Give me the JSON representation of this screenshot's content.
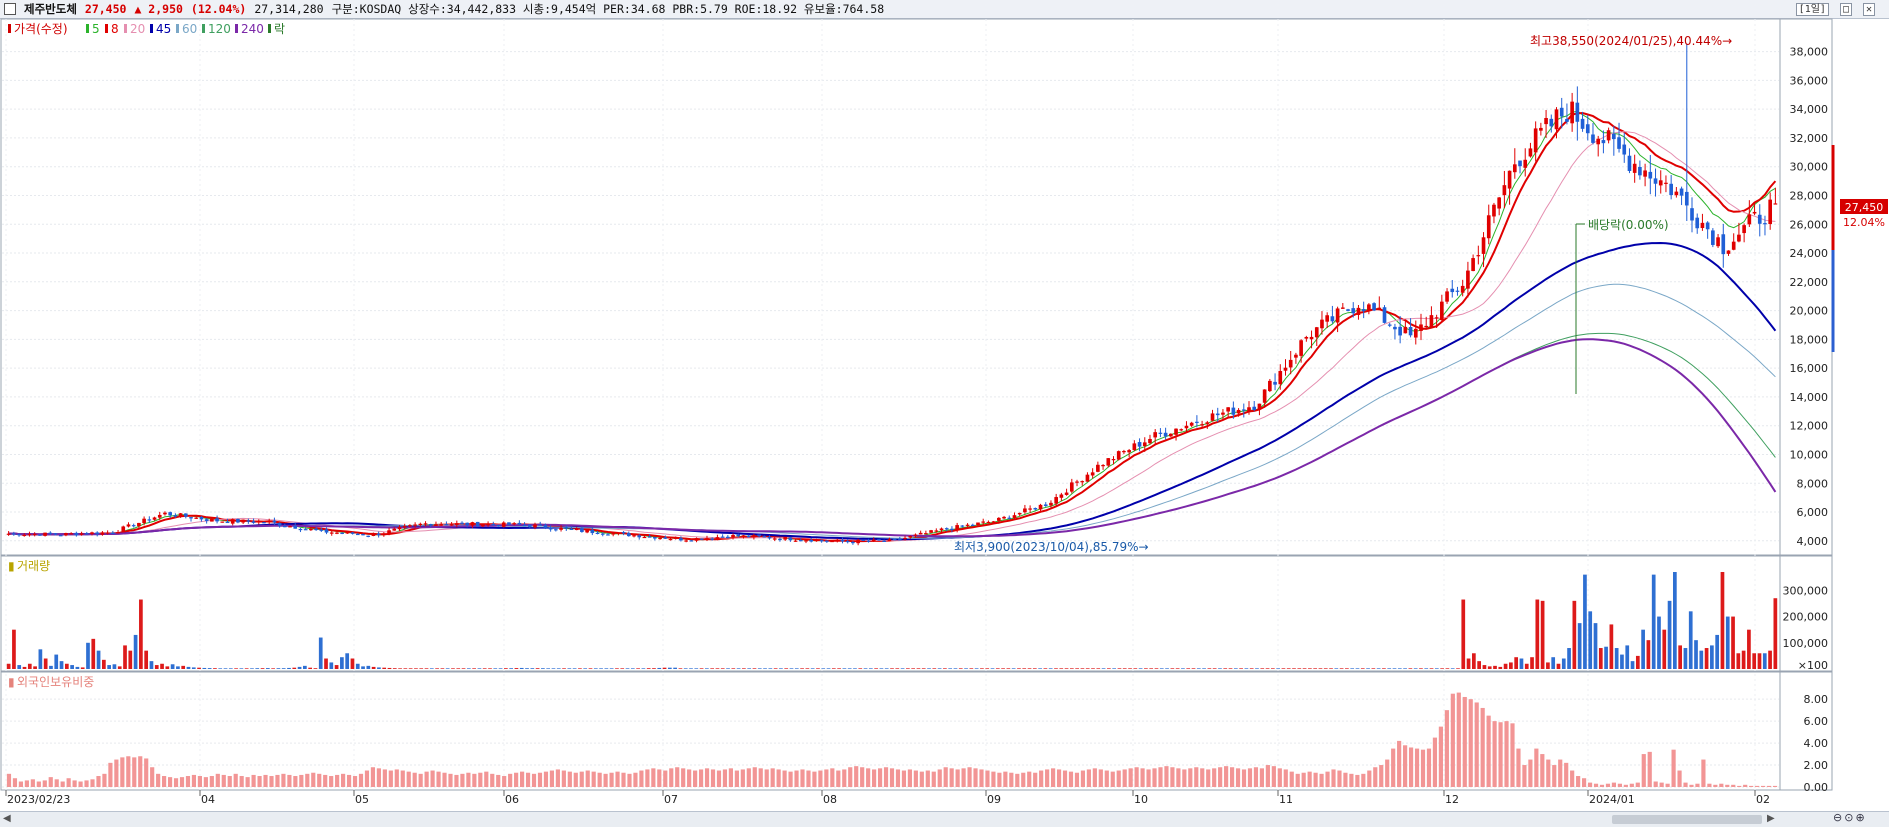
{
  "header": {
    "name": "제주반도체",
    "price": "27,450",
    "change": "▲ 2,950",
    "pct": "(12.04%)",
    "volume": "27,314,280",
    "info": "구분:KOSDAQ 상장수:34,442,833 시총:9,454억 PER:34.68 PBR:5.79 ROE:18.92 유보율:764.58",
    "period": "[1일]",
    "ctrl_min": "□",
    "ctrl_close": "✕"
  },
  "legend_price": [
    {
      "label": "가격(수정)",
      "color": "#d00000"
    },
    {
      "label": "5",
      "color": "#2bb32b"
    },
    {
      "label": "8",
      "color": "#e00000"
    },
    {
      "label": "20",
      "color": "#e58fb0"
    },
    {
      "label": "45",
      "color": "#0000aa"
    },
    {
      "label": "60",
      "color": "#7aa7c7"
    },
    {
      "label": "120",
      "color": "#3f9f5f"
    },
    {
      "label": "240",
      "color": "#7b28a8"
    },
    {
      "label": "락",
      "color": "#2a7a2a"
    }
  ],
  "legend_volume": "거래량",
  "legend_foreign": "외국인보유비중",
  "annotations": {
    "high": "최고38,550(2024/01/25),40.44%→",
    "low": "최저3,900(2023/10/04),85.79%→",
    "dividend": "배당락(0.00%)",
    "last_price": "27,450",
    "last_pct": "12.04%"
  },
  "axes": {
    "price_ticks": [
      "38,000",
      "36,000",
      "34,000",
      "32,000",
      "30,000",
      "28,000",
      "26,000",
      "24,000",
      "22,000",
      "20,000",
      "18,000",
      "16,000",
      "14,000",
      "12,000",
      "10,000",
      "8,000",
      "6,000",
      "4,000"
    ],
    "volume_ticks": [
      "300,000",
      "200,000",
      "100,000",
      "×100"
    ],
    "foreign_ticks": [
      "8.00",
      "6.00",
      "4.00",
      "2.00",
      "0.00"
    ],
    "date_labels": [
      "2023/02/23",
      "04",
      "05",
      "06",
      "07",
      "08",
      "09",
      "10",
      "11",
      "12",
      "2024/01",
      "02"
    ]
  },
  "chart_data": [
    {
      "type": "candlestick",
      "title": "제주반도체",
      "ylim": [
        3500,
        39500
      ],
      "y_unit": "KRW",
      "series": [
        {
          "name": "가격(수정)",
          "anchor_prices": [
            4500,
            4450,
            4600,
            5900,
            5400,
            5300,
            4650,
            4400,
            5200,
            5150,
            5100,
            4700,
            4400,
            4100,
            4350,
            4150,
            3950,
            4000,
            4800,
            5400,
            6600,
            9300,
            11200,
            12500,
            13500,
            18300,
            20600,
            18100,
            22000,
            30500,
            34000,
            31000,
            28500,
            24500,
            27450
          ]
        },
        {
          "name": "5",
          "last_value": 28500
        },
        {
          "name": "8",
          "last_value": 29000
        },
        {
          "name": "20",
          "last_value": 26200
        },
        {
          "name": "45",
          "last_value": 18600
        },
        {
          "name": "60",
          "last_value": 15400
        },
        {
          "name": "120",
          "last_value": 9800
        },
        {
          "name": "240",
          "last_value": 7400
        }
      ],
      "high": {
        "value": 38550,
        "date": "2024/01/25",
        "pct": 40.44
      },
      "low": {
        "value": 3900,
        "date": "2023/10/04",
        "pct": 85.79
      },
      "last": {
        "price": 27450,
        "pct": 12.04
      }
    },
    {
      "type": "bar",
      "title": "거래량",
      "ylim": [
        0,
        370000
      ],
      "values": [
        20000,
        150000,
        15000,
        8000,
        20000,
        10000,
        75000,
        40000,
        12000,
        55000,
        30000,
        20000,
        15000,
        8000,
        6000,
        100000,
        115000,
        70000,
        35000,
        15000,
        18000,
        10000,
        90000,
        70000,
        130000,
        265000,
        70000,
        30000,
        15000,
        20000,
        10000,
        18000,
        10000,
        12000,
        8000,
        6000,
        5000,
        4000,
        3500,
        3000,
        2500,
        2500,
        2500,
        2500,
        2500,
        2500,
        2500,
        3000,
        3000,
        3500,
        2500,
        3000,
        3000,
        4000,
        5000,
        8000,
        12000,
        5000,
        3000,
        120000,
        40000,
        25000,
        15000,
        45000,
        60000,
        40000,
        20000,
        10000,
        12000,
        8000,
        6000,
        5000,
        4000,
        3000,
        2500,
        2500,
        2500,
        2500,
        2500,
        2500,
        2500,
        2500,
        2500,
        2500,
        2500,
        2500,
        2500,
        2500,
        2500,
        2500,
        2500,
        2500,
        2500,
        2500,
        3000,
        3000,
        3500,
        4000,
        3000,
        3000,
        3000,
        3000,
        2500,
        2500,
        2500,
        2500,
        2500,
        2500,
        2500,
        2500,
        2500,
        2500,
        2500,
        2500,
        2500,
        2500,
        2500,
        2500,
        2500,
        2500,
        2500,
        3000,
        3000,
        4000,
        5000,
        5000,
        5000,
        2500,
        2500,
        2500,
        2500,
        2500,
        2500,
        2500,
        2500,
        2500,
        2500,
        2500,
        2500,
        2500,
        2500,
        2500,
        2500,
        2500,
        2500,
        2500,
        2500,
        2500,
        2500,
        2500,
        2500,
        2500,
        2500,
        2500,
        2500,
        2500,
        2500,
        2500,
        2500,
        2500,
        2500,
        2500,
        2500,
        2500,
        2500,
        2500,
        2500,
        2500,
        2500,
        2500,
        2500,
        2500,
        2500,
        2500,
        2500,
        2500,
        2500,
        2500,
        2500,
        2500,
        2500,
        2500,
        2500,
        2500,
        2500,
        2500,
        2500,
        2500,
        2500,
        2500,
        2500,
        2500,
        2500,
        2500,
        2500,
        2500,
        2500,
        2500,
        2500,
        2500,
        2500,
        2500,
        2500,
        2500,
        2500,
        2500,
        2500,
        2500,
        2500,
        2500,
        2500,
        2500,
        2500,
        2500,
        2500,
        2500,
        2500,
        2500,
        2500,
        2500,
        2500,
        2500,
        2500,
        2500,
        2500,
        2500,
        2500,
        2500,
        2500,
        2500,
        2500,
        2500,
        2500,
        2500,
        2500,
        2500,
        2500,
        2500,
        2500,
        2500,
        2500,
        2500,
        2500,
        2500,
        2500,
        2500,
        2500,
        2500,
        2500,
        2500,
        2500,
        2500,
        2500,
        2500,
        2500,
        2500,
        2500,
        2500,
        2500,
        2500,
        2500,
        2500,
        2500,
        2500,
        2500,
        2500,
        2500,
        2500,
        2500,
        2500,
        2500,
        2500,
        2500,
        2500,
        2500,
        265000,
        40000,
        60000,
        30000,
        15000,
        10000,
        12000,
        8000,
        20000,
        25000,
        45000,
        40000,
        20000,
        45000,
        265000,
        260000,
        25000,
        45000,
        20000,
        40000,
        80000,
        260000,
        175000,
        360000,
        220000,
        175000,
        80000,
        85000,
        170000,
        80000,
        55000,
        90000,
        30000,
        50000,
        150000,
        110000,
        360000,
        200000,
        150000,
        260000,
        370000,
        90000,
        80000,
        220000,
        110000,
        70000,
        80000,
        90000,
        130000,
        370000,
        200000,
        200000,
        60000,
        70000,
        150000,
        60000,
        60000,
        60000,
        70000,
        270000
      ]
    },
    {
      "type": "bar",
      "title": "외국인보유비중",
      "ylim": [
        0,
        9.2
      ],
      "y_unit": "%",
      "values": [
        1.2,
        0.8,
        0.5,
        0.6,
        0.7,
        0.5,
        0.6,
        0.9,
        0.7,
        0.5,
        0.8,
        0.6,
        0.5,
        0.6,
        0.7,
        1.0,
        1.2,
        2.2,
        2.5,
        2.7,
        2.8,
        2.7,
        2.8,
        2.6,
        1.8,
        1.2,
        1.0,
        0.9,
        0.8,
        0.9,
        1.0,
        1.1,
        1.0,
        0.9,
        1.0,
        1.2,
        1.1,
        1.0,
        1.2,
        1.0,
        0.9,
        1.1,
        1.0,
        1.1,
        1.0,
        1.1,
        1.2,
        1.1,
        1.0,
        1.1,
        1.2,
        1.3,
        1.2,
        1.1,
        1.0,
        1.1,
        1.2,
        1.1,
        1.0,
        1.2,
        1.5,
        1.8,
        1.7,
        1.6,
        1.5,
        1.6,
        1.5,
        1.4,
        1.3,
        1.2,
        1.4,
        1.5,
        1.4,
        1.3,
        1.2,
        1.1,
        1.2,
        1.3,
        1.2,
        1.3,
        1.4,
        1.2,
        1.1,
        1.0,
        1.2,
        1.3,
        1.4,
        1.3,
        1.2,
        1.3,
        1.4,
        1.5,
        1.6,
        1.5,
        1.4,
        1.3,
        1.4,
        1.5,
        1.4,
        1.3,
        1.2,
        1.3,
        1.4,
        1.3,
        1.2,
        1.3,
        1.5,
        1.6,
        1.7,
        1.6,
        1.5,
        1.7,
        1.8,
        1.7,
        1.6,
        1.5,
        1.6,
        1.7,
        1.6,
        1.5,
        1.6,
        1.7,
        1.5,
        1.6,
        1.7,
        1.8,
        1.7,
        1.6,
        1.7,
        1.6,
        1.5,
        1.4,
        1.5,
        1.6,
        1.5,
        1.4,
        1.5,
        1.6,
        1.7,
        1.5,
        1.6,
        1.8,
        1.9,
        1.8,
        1.7,
        1.6,
        1.7,
        1.8,
        1.7,
        1.6,
        1.5,
        1.6,
        1.5,
        1.4,
        1.5,
        1.4,
        1.6,
        1.8,
        1.7,
        1.6,
        1.7,
        1.8,
        1.7,
        1.6,
        1.5,
        1.4,
        1.3,
        1.4,
        1.3,
        1.2,
        1.3,
        1.4,
        1.3,
        1.5,
        1.6,
        1.7,
        1.6,
        1.5,
        1.4,
        1.3,
        1.5,
        1.6,
        1.7,
        1.6,
        1.5,
        1.4,
        1.5,
        1.6,
        1.7,
        1.8,
        1.7,
        1.6,
        1.7,
        1.8,
        1.9,
        1.8,
        1.7,
        1.6,
        1.7,
        1.8,
        1.7,
        1.6,
        1.7,
        1.8,
        1.9,
        1.8,
        1.7,
        1.6,
        1.7,
        1.8,
        1.7,
        2.0,
        1.9,
        1.7,
        1.6,
        1.4,
        1.2,
        1.3,
        1.4,
        1.3,
        1.2,
        1.4,
        1.6,
        1.5,
        1.3,
        1.2,
        1.1,
        1.2,
        1.5,
        1.8,
        2.0,
        2.5,
        3.5,
        4.2,
        3.8,
        3.6,
        3.5,
        3.4,
        3.5,
        4.5,
        5.5,
        7.0,
        8.5,
        8.6,
        8.2,
        8.0,
        7.7,
        7.2,
        6.5,
        6.0,
        5.9,
        6.0,
        5.8,
        3.5,
        2.0,
        2.5,
        3.5,
        3.0,
        2.5,
        2.0,
        2.5,
        2.2,
        1.5,
        1.0,
        0.8,
        0.4,
        0.3,
        0.2,
        0.3,
        0.4,
        0.3,
        0.2,
        0.3,
        0.4,
        3.0,
        3.2,
        0.5,
        0.4,
        0.3,
        3.4,
        1.5,
        0.4,
        0.2,
        0.3,
        2.5,
        0.3,
        0.2,
        0.3,
        0.2,
        0.2,
        0.1,
        0.2,
        0.1,
        0.1,
        0.1,
        0.1,
        0.1
      ]
    }
  ]
}
